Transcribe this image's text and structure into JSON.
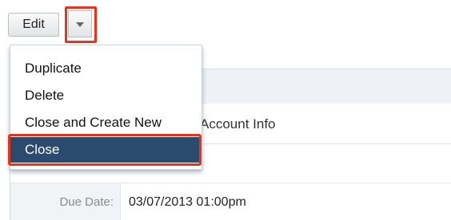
{
  "toolbar": {
    "edit_label": "Edit",
    "caret_icon": "caret-down-icon"
  },
  "action_menu": {
    "items": [
      {
        "label": "Duplicate"
      },
      {
        "label": "Delete"
      },
      {
        "label": "Close and Create New"
      },
      {
        "label": "Close",
        "state": "highlighted"
      }
    ]
  },
  "detail": {
    "subject_fragment": "Account Info",
    "due_date_label": "Due Date:",
    "due_date_value": "03/07/2013 01:00pm"
  },
  "colors": {
    "highlight_outline": "#e8321a",
    "selected_item_bg": "#2b4b6e",
    "band_bg": "#eef2f6",
    "label_cell_bg": "#f1f4f7"
  }
}
